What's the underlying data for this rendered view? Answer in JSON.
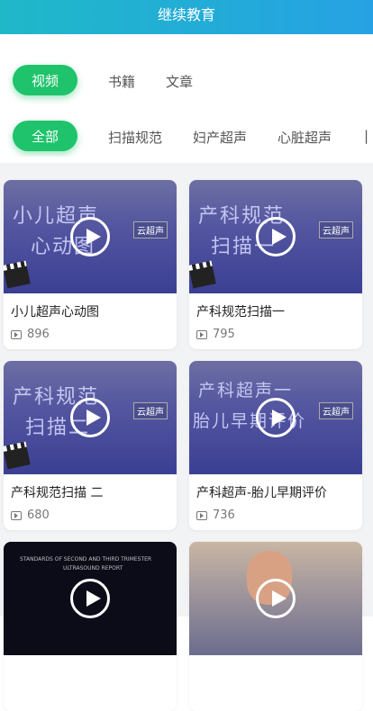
{
  "header": {
    "title": "继续教育"
  },
  "tabs": [
    {
      "label": "视频"
    },
    {
      "label": "书籍"
    },
    {
      "label": "文章"
    }
  ],
  "categories": [
    {
      "label": "全部"
    },
    {
      "label": "扫描规范"
    },
    {
      "label": "妇产超声"
    },
    {
      "label": "心脏超声"
    },
    {
      "label": "|"
    }
  ],
  "cards": [
    {
      "title": "小儿超声心动图",
      "views": "896",
      "thumb_text": [
        "小儿超声",
        "心动图"
      ],
      "tag": "云超声"
    },
    {
      "title": "产科规范扫描一",
      "views": "795",
      "thumb_text": [
        "产科规范",
        "扫描一"
      ],
      "tag": "云超声"
    },
    {
      "title": "产科规范扫描 二",
      "views": "680",
      "thumb_text": [
        "产科规范",
        "扫描二"
      ],
      "tag": "云超声"
    },
    {
      "title": "产科超声-胎儿早期评价",
      "views": "736",
      "thumb_text": [
        "产科超声一",
        "胎儿早期评价"
      ],
      "tag": "云超声"
    },
    {
      "title": "",
      "views": "",
      "thumb_text": [
        "STANDARDS OF SECOND AND THIRD TRIMESTER",
        "ULTRASOUND REPORT"
      ]
    },
    {
      "title": "",
      "views": "",
      "thumb_text": []
    }
  ]
}
